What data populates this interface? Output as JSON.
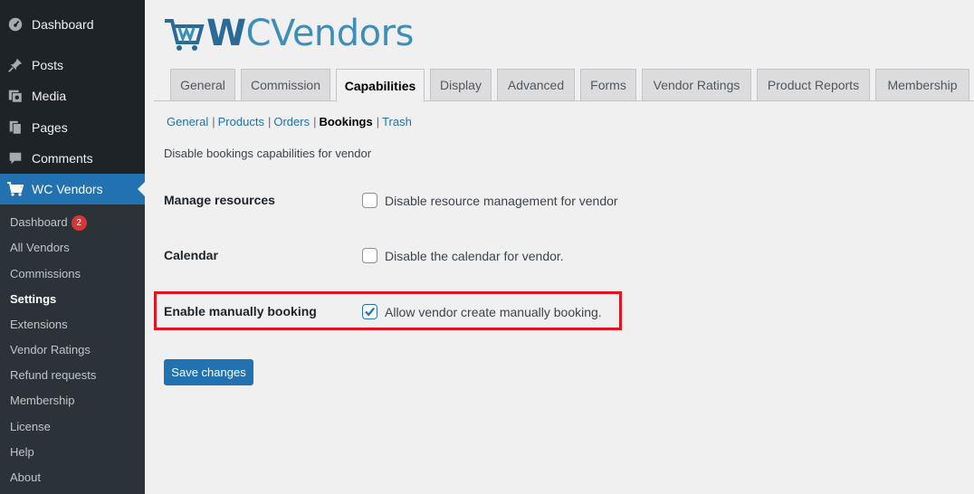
{
  "sidebar": {
    "top_items": [
      {
        "label": "Dashboard",
        "icon": "dashboard-icon"
      },
      {
        "label": "Posts",
        "icon": "pin-icon"
      },
      {
        "label": "Media",
        "icon": "media-icon"
      },
      {
        "label": "Pages",
        "icon": "pages-icon"
      },
      {
        "label": "Comments",
        "icon": "comments-icon"
      },
      {
        "label": "WC Vendors",
        "icon": "cart-icon"
      }
    ],
    "submenu": [
      {
        "label": "Dashboard",
        "badge": "2"
      },
      {
        "label": "All Vendors"
      },
      {
        "label": "Commissions"
      },
      {
        "label": "Settings"
      },
      {
        "label": "Extensions"
      },
      {
        "label": "Vendor Ratings"
      },
      {
        "label": "Refund requests"
      },
      {
        "label": "Membership"
      },
      {
        "label": "License"
      },
      {
        "label": "Help"
      },
      {
        "label": "About"
      }
    ]
  },
  "logo": {
    "text_w": "W",
    "text_rest": "CVendors"
  },
  "tabs": [
    {
      "label": "General"
    },
    {
      "label": "Commission"
    },
    {
      "label": "Capabilities"
    },
    {
      "label": "Display"
    },
    {
      "label": "Advanced"
    },
    {
      "label": "Forms"
    },
    {
      "label": "Vendor Ratings"
    },
    {
      "label": "Product Reports"
    },
    {
      "label": "Membership"
    }
  ],
  "subnav": [
    {
      "label": "General"
    },
    {
      "label": "Products"
    },
    {
      "label": "Orders"
    },
    {
      "label": "Bookings"
    },
    {
      "label": "Trash"
    }
  ],
  "description": "Disable bookings capabilities for vendor",
  "settings": [
    {
      "label": "Manage resources",
      "field": "Disable resource management for vendor",
      "checked": false
    },
    {
      "label": "Calendar",
      "field": "Disable the calendar for vendor.",
      "checked": false
    },
    {
      "label": "Enable manually booking",
      "field": "Allow vendor create manually booking.",
      "checked": true
    }
  ],
  "save_button": "Save changes",
  "colors": {
    "accent": "#2271b1",
    "highlight": "#e0151f",
    "sidebar": "#1d2327",
    "badge": "#d63638"
  }
}
